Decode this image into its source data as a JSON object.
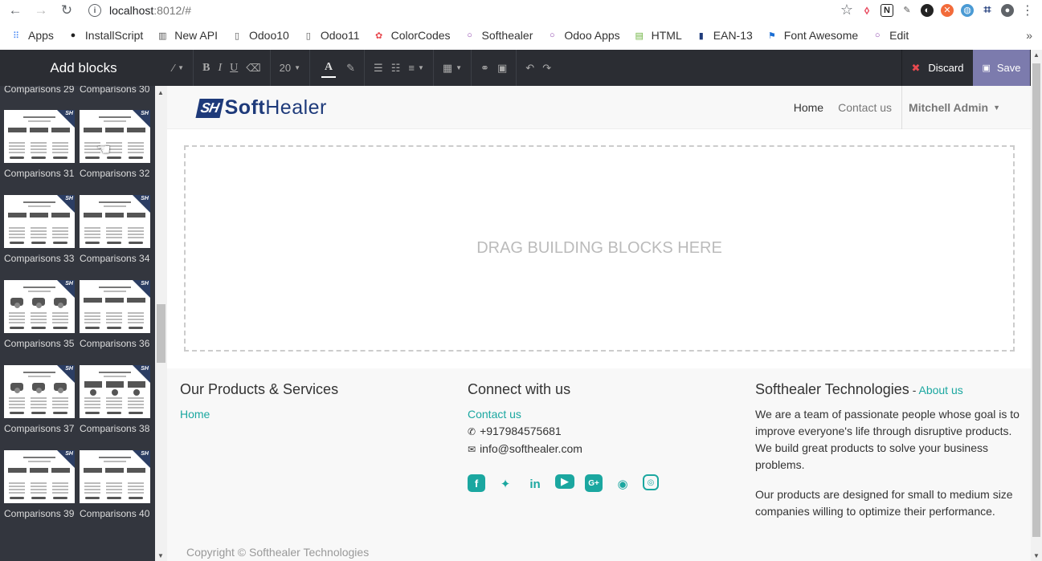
{
  "browser": {
    "url_host": "localhost",
    "url_rest": ":8012/#",
    "info_glyph": "i",
    "back_glyph": "←",
    "forward_glyph": "→",
    "reload_glyph": "↻",
    "star_glyph": "☆",
    "menu_glyph": "⋮",
    "bookmarks": [
      {
        "label": "Apps",
        "icon": "apps-grid-icon"
      },
      {
        "label": "InstallScript",
        "icon": "github-icon"
      },
      {
        "label": "New API",
        "icon": "book-icon"
      },
      {
        "label": "Odoo10",
        "icon": "page-icon"
      },
      {
        "label": "Odoo11",
        "icon": "page-icon"
      },
      {
        "label": "ColorCodes",
        "icon": "color-wheel-icon"
      },
      {
        "label": "Softhealer",
        "icon": "circle-icon"
      },
      {
        "label": "Odoo Apps",
        "icon": "circle-icon"
      },
      {
        "label": "HTML",
        "icon": "html-icon"
      },
      {
        "label": "EAN-13",
        "icon": "barcode-icon"
      },
      {
        "label": "Font Awesome",
        "icon": "flag-icon"
      },
      {
        "label": "Edit",
        "icon": "circle-icon"
      }
    ],
    "bookmarks_more": "»"
  },
  "editor": {
    "add_blocks": "Add blocks",
    "font_size": "20",
    "color_letter": "A",
    "discard": "Discard",
    "save": "Save"
  },
  "sidebar": {
    "top_labels": [
      "Comparisons 29",
      "Comparisons 30"
    ],
    "blocks": [
      "Comparisons 31",
      "Comparisons 32",
      "Comparisons 33",
      "Comparisons 34",
      "Comparisons 35",
      "Comparisons 36",
      "Comparisons 37",
      "Comparisons 38",
      "Comparisons 39",
      "Comparisons 40"
    ],
    "badge": "SH"
  },
  "site": {
    "logo_mark": "SH",
    "logo_word_a": "Soft",
    "logo_word_b": "Healer",
    "menu": [
      "Home",
      "Contact us"
    ],
    "user": "Mitchell Admin",
    "dropzone": "DRAG BUILDING BLOCKS HERE",
    "footer": {
      "col1_title": "Our Products & Services",
      "col1_link": "Home",
      "col2_title": "Connect with us",
      "col2_link": "Contact us",
      "phone": "+917984575681",
      "email": "info@softhealer.com",
      "col3_title": "Softhealer Technologies",
      "col3_dash": " - ",
      "col3_link": "About us",
      "para1": "We are a team of passionate people whose goal is to improve everyone's life through disruptive products. We build great products to solve your business problems.",
      "para2": "Our products are designed for small to medium size companies willing to optimize their performance.",
      "copyright": "Copyright © Softhealer Technologies"
    }
  },
  "colors": {
    "accent": "#1ba7a0",
    "save_bg": "#7c7bad",
    "editor_bg": "#2b2d33",
    "sidebar_bg": "#33363e",
    "logo_blue": "#1e3a7a"
  }
}
